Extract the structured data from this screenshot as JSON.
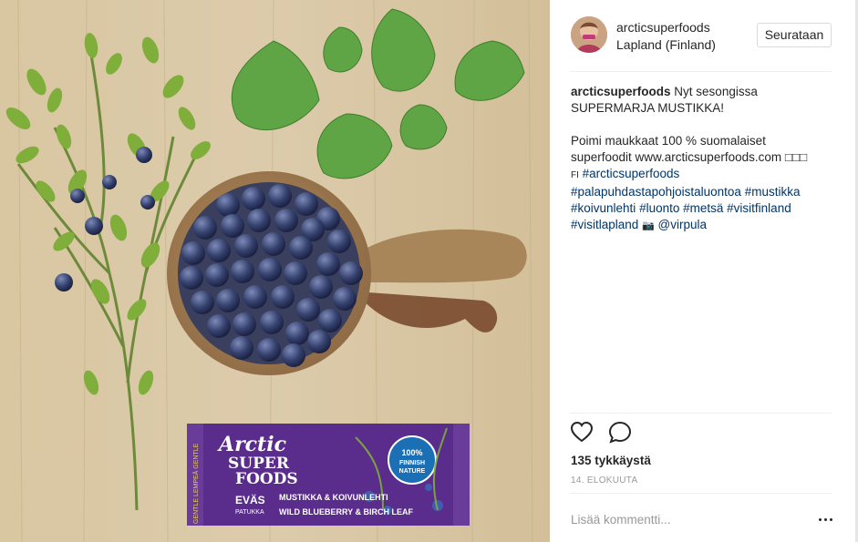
{
  "post": {
    "username": "arcticsuperfoods",
    "location": "Lapland (Finland)",
    "follow_label": "Seurataan",
    "caption": {
      "line1": "Nyt sesongissa",
      "line2": "SUPERMARJA MUSTIKKA!",
      "line3": "Poimi maukkaat 100 % suomalaiset",
      "line4": "superfoodit www.arcticsuperfoods.com □□□",
      "line5_prefix": "FI",
      "tag1": "#arcticsuperfoods",
      "tag2": "#palapuhdastapohjoistaluontoa",
      "tag3": "#mustikka",
      "tag4": "#koivunlehti",
      "tag5": "#luonto",
      "tag6": "#metsä",
      "tag7": "#visitfinland",
      "tag8": "#visitlapland",
      "camera": "📷",
      "mention": "@virpula"
    },
    "likes": "135 tykkäystä",
    "date": "14. ELOKUUTA",
    "comment_placeholder": "Lisää kommentti..."
  },
  "product": {
    "brand1": "Arctic",
    "brand2": "SUPER",
    "brand3": "FOODS",
    "line_name": "EVÄS",
    "line_sub": "PATUKKA",
    "flavor_fi": "MUSTIKKA & KOIVUNLEHTI",
    "flavor_en": "WILD BLUEBERRY & BIRCH LEAF",
    "badge1": "100%",
    "badge2": "FINNISH",
    "badge3": "NATURE",
    "side_text": "GENTLE LEMPEÄ GENTLE"
  },
  "colors": {
    "link": "#003569",
    "wrapper": "#5a2d8c",
    "badge": "#1b6fb5",
    "wood": "#d8c6a3"
  },
  "icons": [
    "heart-icon",
    "comment-icon",
    "more-options-icon",
    "camera-icon"
  ]
}
